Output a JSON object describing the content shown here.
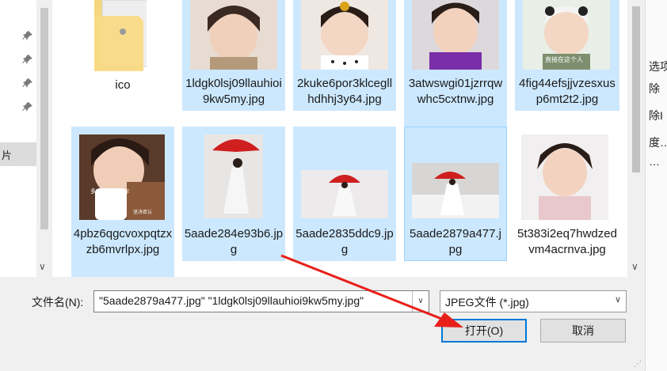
{
  "nav": {
    "fragment_label": "片"
  },
  "files": [
    {
      "label": "ico",
      "selected": false,
      "kind": "folder"
    },
    {
      "label": "1ldgk0lsj09llauhioi9kw5my.jpg",
      "selected": true,
      "kind": "photo"
    },
    {
      "label": "2kuke6por3klcegllhdhhj3y64.jpg",
      "selected": true,
      "kind": "photo"
    },
    {
      "label": "3atwswgi01jzrrqwwhc5cxtnw.jpg",
      "selected": true,
      "kind": "photo"
    },
    {
      "label": "4fig44efsjjvzesxusp6mt2t2.jpg",
      "selected": true,
      "kind": "photo"
    },
    {
      "label": "4pbz6qgcvoxpqtzxzb6mvrlpx.jpg",
      "selected": true,
      "kind": "photo"
    },
    {
      "label": "5aade284e93b6.jpg",
      "selected": true,
      "kind": "photo"
    },
    {
      "label": "5aade2835ddc9.jpg",
      "selected": true,
      "kind": "photo"
    },
    {
      "label": "5aade2879a477.jpg",
      "selected": true,
      "kind": "photo"
    },
    {
      "label": "5t383i2eq7hwdzedvm4acrnva.jpg",
      "selected": false,
      "kind": "photo"
    }
  ],
  "thumb_texts": {
    "cup_caption": "多喝点热水吧你",
    "cup_sub": "坚决否认",
    "kid_caption": "直接在这个人"
  },
  "filename": {
    "label": "文件名(N):",
    "value": "\"5aade2879a477.jpg\" \"1ldgk0lsj09llauhioi9kw5my.jpg\""
  },
  "filetype": {
    "value": "JPEG文件 (*.jpg)"
  },
  "buttons": {
    "open": "打开(O)",
    "cancel": "取消"
  },
  "background_app": {
    "lines": [
      "选项",
      "除",
      "除I",
      "度…",
      "…"
    ]
  },
  "colors": {
    "selection": "#cce8ff",
    "accent": "#0078d7",
    "annotation_arrow": "#e8201a"
  }
}
